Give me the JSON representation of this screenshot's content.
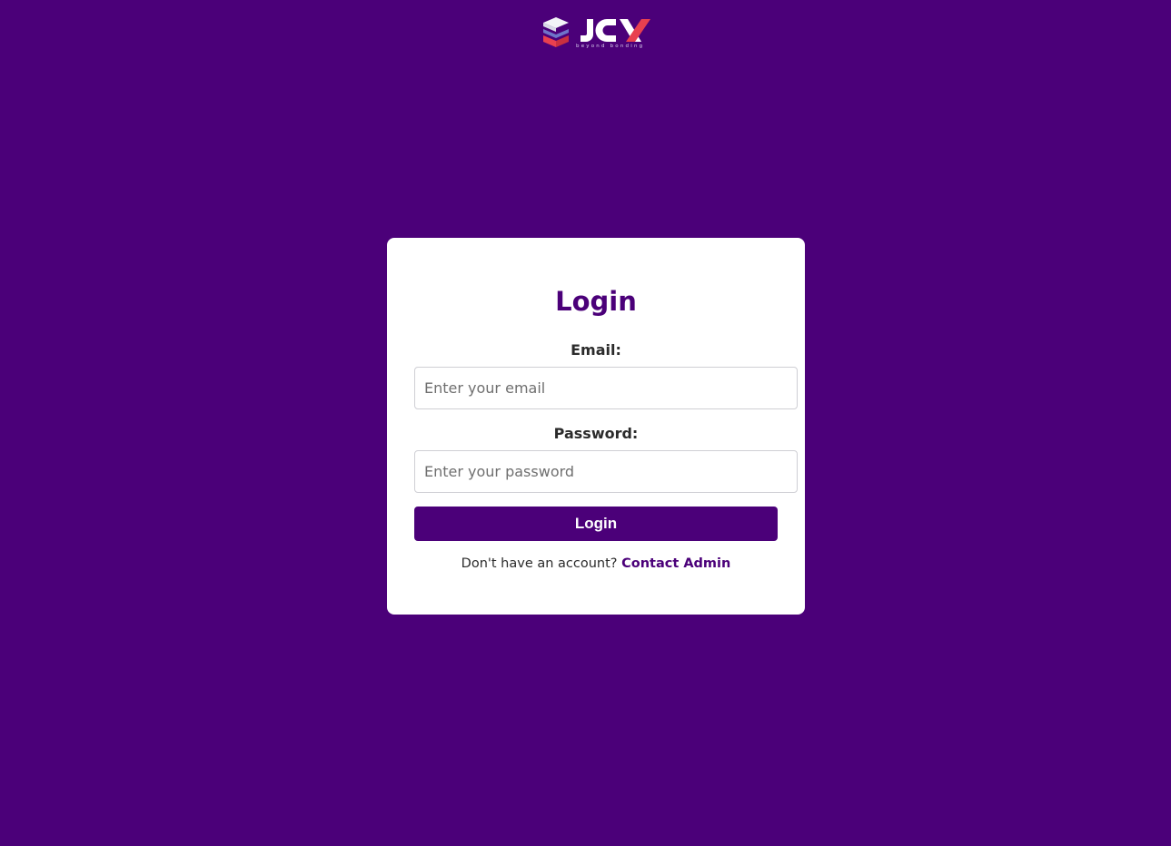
{
  "brand": {
    "logo_text": "JCX",
    "tagline": "beyond bonding",
    "colors": {
      "cube_light": "#f3f3f7",
      "cube_blue": "#6e74c9",
      "cube_red": "#e8404f",
      "x_red": "#e8404f"
    }
  },
  "theme": {
    "background": "#4b0079",
    "card": "#ffffff",
    "accent": "#4b0079"
  },
  "login": {
    "title": "Login",
    "email_label": "Email:",
    "email_placeholder": "Enter your email",
    "email_value": "",
    "password_label": "Password:",
    "password_placeholder": "Enter your password",
    "password_value": "",
    "submit_label": "Login",
    "signup_prompt": "Don't have an account?",
    "signup_link": "Contact Admin"
  }
}
